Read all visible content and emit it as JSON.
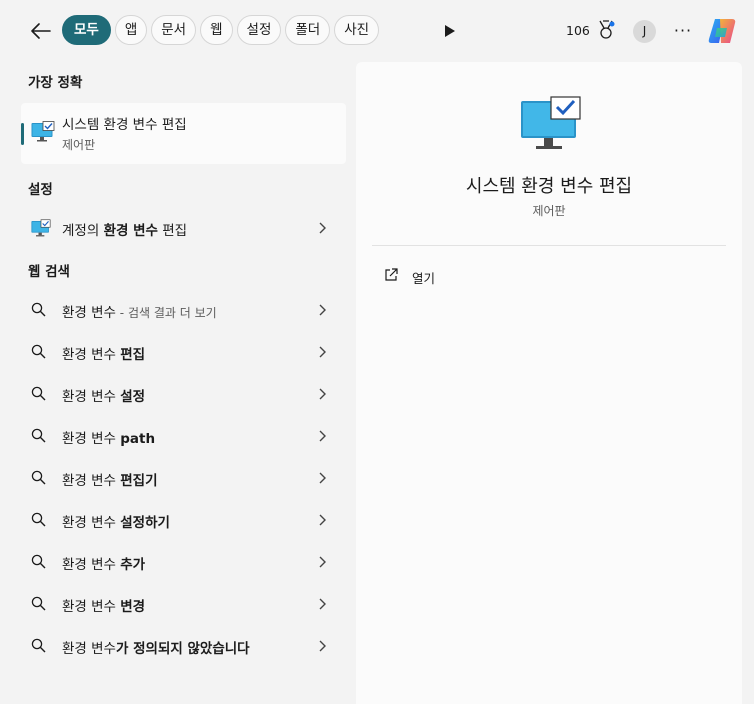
{
  "topbar": {
    "tabs": [
      "모두",
      "앱",
      "문서",
      "웹",
      "설정",
      "폴더",
      "사진"
    ],
    "points": "106",
    "avatar_initial": "J",
    "more_label": "···"
  },
  "left": {
    "best_match_header": "가장 정확",
    "best_match": {
      "title": "시스템 환경 변수 편집",
      "subtitle": "제어판"
    },
    "settings_header": "설정",
    "settings_item": {
      "plain": "계정의 ",
      "bold": "환경 변수",
      "tail": " 편집"
    },
    "web_header": "웹 검색",
    "web_items": [
      {
        "plain": "환경 변수",
        "bold": "",
        "sub": " - 검색 결과 더 보기"
      },
      {
        "plain": "환경 변수 ",
        "bold": "편집",
        "sub": ""
      },
      {
        "plain": "환경 변수 ",
        "bold": "설정",
        "sub": ""
      },
      {
        "plain": "환경 변수 ",
        "bold": "path",
        "sub": ""
      },
      {
        "plain": "환경 변수 ",
        "bold": "편집기",
        "sub": ""
      },
      {
        "plain": "환경 변수 ",
        "bold": "설정하기",
        "sub": ""
      },
      {
        "plain": "환경 변수 ",
        "bold": "추가",
        "sub": ""
      },
      {
        "plain": "환경 변수 ",
        "bold": "변경",
        "sub": ""
      },
      {
        "plain": "환경 변수",
        "bold": "가 정의되지 않았습니다",
        "sub": ""
      }
    ]
  },
  "right": {
    "title": "시스템 환경 변수 편집",
    "subtitle": "제어판",
    "open_label": "열기"
  },
  "colors": {
    "accent": "#1f6b78",
    "panel": "#fbfbfb",
    "background": "#f3f3f3"
  }
}
